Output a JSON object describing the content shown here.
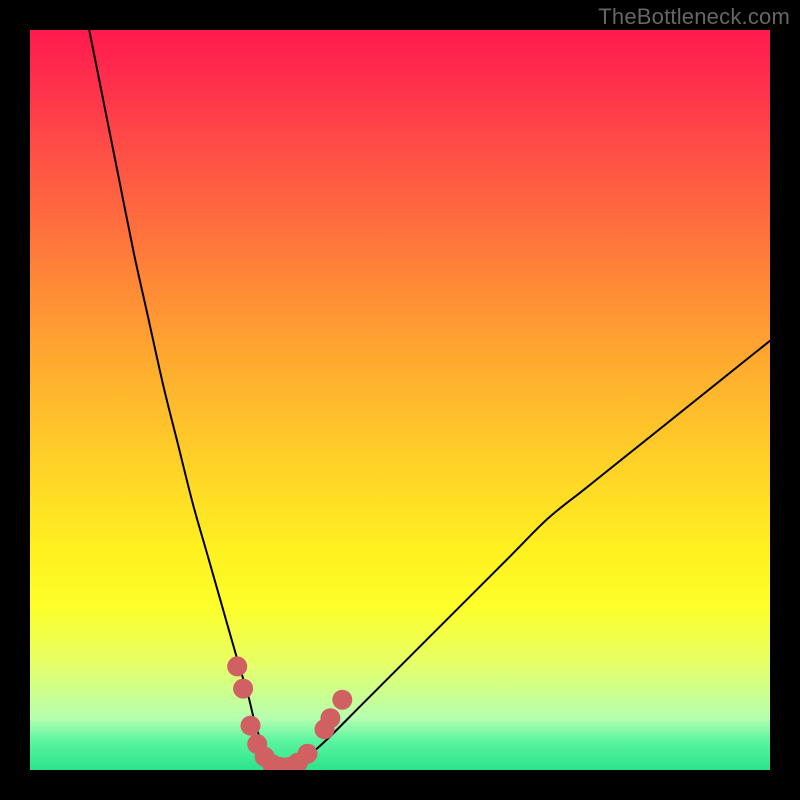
{
  "watermark": "TheBottleneck.com",
  "chart_data": {
    "type": "line",
    "title": "",
    "xlabel": "",
    "ylabel": "",
    "xlim": [
      0,
      100
    ],
    "ylim": [
      0,
      100
    ],
    "grid": false,
    "series": [
      {
        "name": "bottleneck-curve",
        "x": [
          8,
          10,
          12,
          14,
          16,
          18,
          20,
          22,
          24,
          26,
          28,
          29.5,
          30.5,
          32,
          33.5,
          35,
          36.5,
          40,
          45,
          50,
          55,
          60,
          65,
          70,
          75,
          80,
          85,
          90,
          95,
          100
        ],
        "values": [
          100,
          90,
          80,
          70,
          61,
          52,
          44,
          36,
          29,
          22,
          15,
          10,
          6,
          2,
          0,
          0,
          1,
          4,
          9,
          14,
          19,
          24,
          29,
          34,
          38,
          42,
          46,
          50,
          54,
          58
        ]
      }
    ],
    "markers": {
      "name": "highlight-points",
      "color": "#d16062",
      "points": [
        {
          "x": 28.0,
          "y": 14
        },
        {
          "x": 28.8,
          "y": 11
        },
        {
          "x": 29.8,
          "y": 6
        },
        {
          "x": 30.7,
          "y": 3.5
        },
        {
          "x": 31.7,
          "y": 1.8
        },
        {
          "x": 32.7,
          "y": 0.8
        },
        {
          "x": 33.8,
          "y": 0.4
        },
        {
          "x": 35.0,
          "y": 0.4
        },
        {
          "x": 36.2,
          "y": 1.0
        },
        {
          "x": 37.5,
          "y": 2.2
        },
        {
          "x": 39.8,
          "y": 5.5
        },
        {
          "x": 40.6,
          "y": 7.0
        },
        {
          "x": 42.2,
          "y": 9.5
        }
      ]
    },
    "gradient_stops": [
      {
        "pos": 0,
        "color": "#ff1a4f"
      },
      {
        "pos": 7,
        "color": "#ff2f4c"
      },
      {
        "pos": 15,
        "color": "#ff4a47"
      },
      {
        "pos": 25,
        "color": "#ff6a3f"
      },
      {
        "pos": 35,
        "color": "#ff8b36"
      },
      {
        "pos": 45,
        "color": "#ffab2f"
      },
      {
        "pos": 58,
        "color": "#ffd028"
      },
      {
        "pos": 70,
        "color": "#fff020"
      },
      {
        "pos": 78,
        "color": "#fdff2a"
      },
      {
        "pos": 85,
        "color": "#e9ff62"
      },
      {
        "pos": 93,
        "color": "#b6ffb0"
      },
      {
        "pos": 96,
        "color": "#5cf5a0"
      },
      {
        "pos": 100,
        "color": "#2be48b"
      }
    ]
  }
}
